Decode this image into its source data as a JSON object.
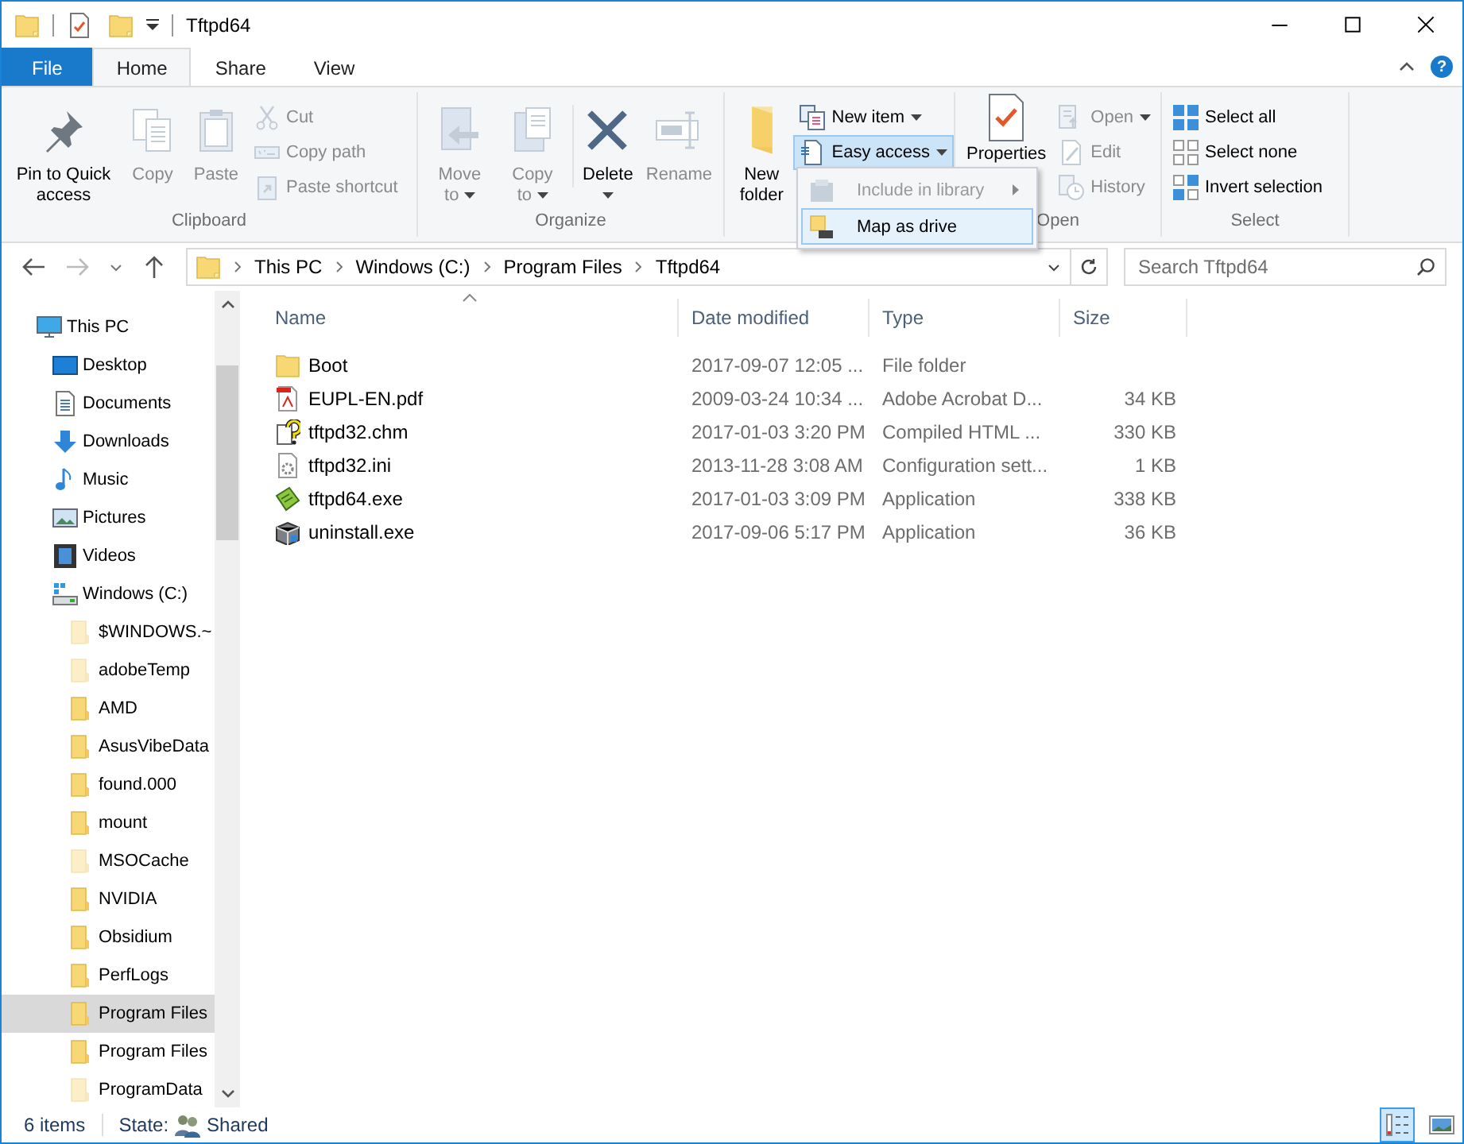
{
  "window": {
    "title": "Tftpd64"
  },
  "ribbon_tabs": [
    {
      "label": "File",
      "kind": "file",
      "selected": false
    },
    {
      "label": "Home",
      "kind": "tab",
      "selected": true
    },
    {
      "label": "Share",
      "kind": "tab",
      "selected": false
    },
    {
      "label": "View",
      "kind": "tab",
      "selected": false
    }
  ],
  "help_button": "?",
  "ribbon": {
    "clipboard": {
      "label": "Clipboard",
      "pin": {
        "label": "Pin to Quick access",
        "disabled": false
      },
      "copy": {
        "label": "Copy",
        "disabled": true
      },
      "paste": {
        "label": "Paste",
        "disabled": true
      },
      "cut": {
        "label": "Cut",
        "disabled": true
      },
      "copy_path": {
        "label": "Copy path",
        "disabled": true
      },
      "paste_shortcut": {
        "label": "Paste shortcut",
        "disabled": true
      }
    },
    "organize": {
      "label": "Organize",
      "move_to": {
        "label": "Move to",
        "disabled": true
      },
      "copy_to": {
        "label": "Copy to",
        "disabled": true
      },
      "delete": {
        "label": "Delete",
        "disabled": false
      },
      "rename": {
        "label": "Rename",
        "disabled": true
      }
    },
    "new": {
      "new_folder": {
        "label": "New folder",
        "disabled": false
      },
      "new_item": {
        "label": "New item",
        "disabled": false
      },
      "easy_access": {
        "label": "Easy access",
        "disabled": false,
        "expanded": true
      }
    },
    "open": {
      "label": "Open",
      "properties": {
        "label": "Properties",
        "disabled": false
      },
      "open": {
        "label": "Open",
        "disabled": true
      },
      "edit": {
        "label": "Edit",
        "disabled": true
      },
      "history": {
        "label": "History",
        "disabled": true
      }
    },
    "select": {
      "label": "Select",
      "select_all": {
        "label": "Select all",
        "disabled": false
      },
      "select_none": {
        "label": "Select none",
        "disabled": false
      },
      "invert": {
        "label": "Invert selection",
        "disabled": false
      }
    }
  },
  "easy_access_menu": [
    {
      "label": "Include in library",
      "disabled": true,
      "selected": false
    },
    {
      "label": "Map as drive",
      "disabled": false,
      "selected": true
    }
  ],
  "address_bar": {
    "segments": [
      "This PC",
      "Windows (C:)",
      "Program Files",
      "Tftpd64"
    ]
  },
  "search": {
    "placeholder": "Search Tftpd64"
  },
  "navigation": [
    {
      "label": "This PC",
      "kind": "computer",
      "selected": false,
      "children": [
        {
          "label": "Desktop",
          "kind": "desktop",
          "selected": false
        },
        {
          "label": "Documents",
          "kind": "documents",
          "selected": false
        },
        {
          "label": "Downloads",
          "kind": "downloads",
          "selected": false
        },
        {
          "label": "Music",
          "kind": "music",
          "selected": false
        },
        {
          "label": "Pictures",
          "kind": "pictures",
          "selected": false
        },
        {
          "label": "Videos",
          "kind": "videos",
          "selected": false
        },
        {
          "label": "Windows (C:)",
          "kind": "drive",
          "selected": false,
          "children": [
            {
              "label": "$WINDOWS.~",
              "kind": "folder",
              "hidden": true,
              "selected": false
            },
            {
              "label": "adobeTemp",
              "kind": "folder",
              "hidden": true,
              "selected": false
            },
            {
              "label": "AMD",
              "kind": "folder",
              "hidden": false,
              "selected": false
            },
            {
              "label": "AsusVibeData",
              "kind": "folder",
              "hidden": false,
              "selected": false
            },
            {
              "label": "found.000",
              "kind": "folder",
              "hidden": false,
              "selected": false
            },
            {
              "label": "mount",
              "kind": "folder",
              "hidden": false,
              "selected": false
            },
            {
              "label": "MSOCache",
              "kind": "folder",
              "hidden": true,
              "selected": false
            },
            {
              "label": "NVIDIA",
              "kind": "folder",
              "hidden": false,
              "selected": false
            },
            {
              "label": "Obsidium",
              "kind": "folder",
              "hidden": false,
              "selected": false
            },
            {
              "label": "PerfLogs",
              "kind": "folder",
              "hidden": false,
              "selected": false
            },
            {
              "label": "Program Files",
              "kind": "folder",
              "hidden": false,
              "selected": true
            },
            {
              "label": "Program Files",
              "kind": "folder",
              "hidden": false,
              "selected": false
            },
            {
              "label": "ProgramData",
              "kind": "folder",
              "hidden": true,
              "selected": false
            }
          ]
        }
      ]
    }
  ],
  "file_list": {
    "columns": [
      "Name",
      "Date modified",
      "Type",
      "Size"
    ],
    "rows": [
      {
        "name": "Boot",
        "kind": "folder",
        "date_modified": "2017-09-07 12:05 ...",
        "type": "File folder"
      },
      {
        "name": "EUPL-EN.pdf",
        "kind": "pdf",
        "date_modified": "2009-03-24 10:34 ...",
        "type": "Adobe Acrobat D...",
        "size": "34 KB"
      },
      {
        "name": "tftpd32.chm",
        "kind": "help",
        "date_modified": "2017-01-03 3:20 PM",
        "type": "Compiled HTML ...",
        "size": "330 KB"
      },
      {
        "name": "tftpd32.ini",
        "kind": "settings",
        "date_modified": "2013-11-28 3:08 AM",
        "type": "Configuration sett...",
        "size": "1 KB"
      },
      {
        "name": "tftpd64.exe",
        "kind": "application",
        "date_modified": "2017-01-03 3:09 PM",
        "type": "Application",
        "size": "338 KB"
      },
      {
        "name": "uninstall.exe",
        "kind": "installer",
        "date_modified": "2017-09-06 5:17 PM",
        "type": "Application",
        "size": "36 KB"
      }
    ]
  },
  "status_bar": {
    "item_count": "6 items",
    "state_label": "State:",
    "state_value": "Shared"
  },
  "view_modes": [
    {
      "selected": true
    },
    {
      "selected": false
    }
  ]
}
